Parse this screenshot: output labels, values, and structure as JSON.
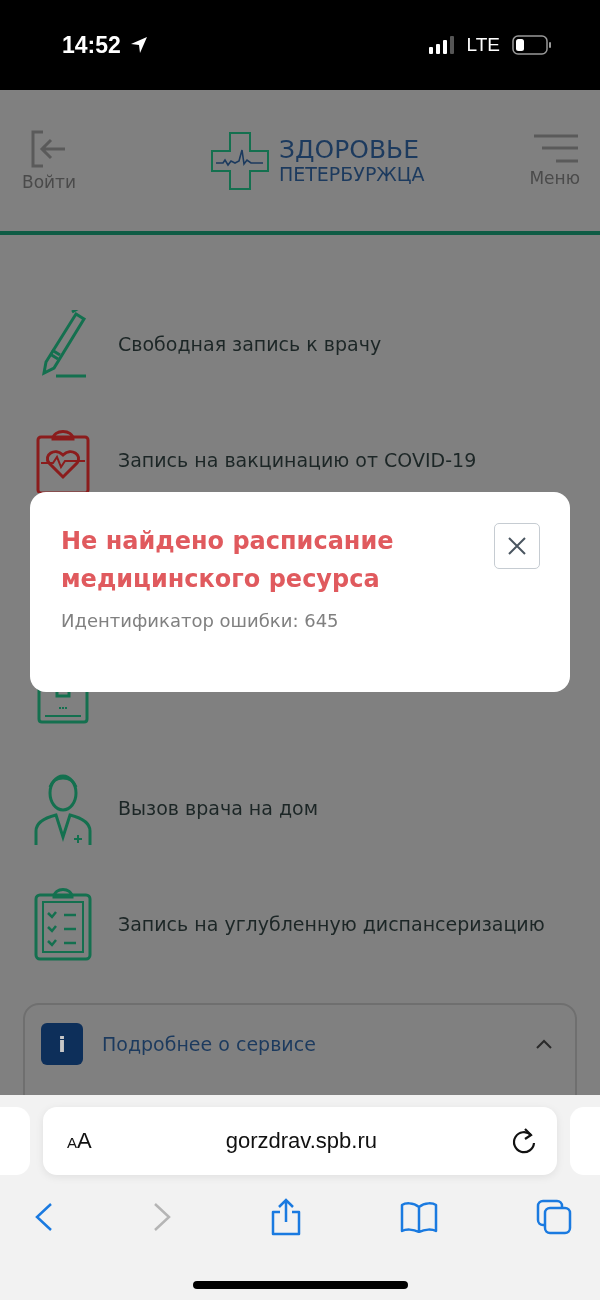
{
  "status_bar": {
    "time": "14:52",
    "network": "LTE"
  },
  "header": {
    "login_label": "Войти",
    "logo_line_1": "ЗДОРОВЬЕ",
    "logo_line_2": "ПЕТЕРБУРЖЦА",
    "menu_label": "Меню"
  },
  "services": [
    {
      "label": "Свободная запись к врачу"
    },
    {
      "label": "Запись на вакцинацию от COVID-19"
    },
    {
      "label": "Вызов врача на дом"
    },
    {
      "label": "Запись на углубленную диспансеризацию"
    }
  ],
  "info_panel": {
    "title": "Подробнее о сервисе",
    "icon_label": "i",
    "expanded": true
  },
  "error_dialog": {
    "title": "Не найдено расписание медицинского ресурса",
    "message": "Идентификатор ошибки: 645"
  },
  "browser": {
    "text_size_button": "AA",
    "url": "gorzdrav.spb.ru",
    "forward_disabled": true
  }
}
